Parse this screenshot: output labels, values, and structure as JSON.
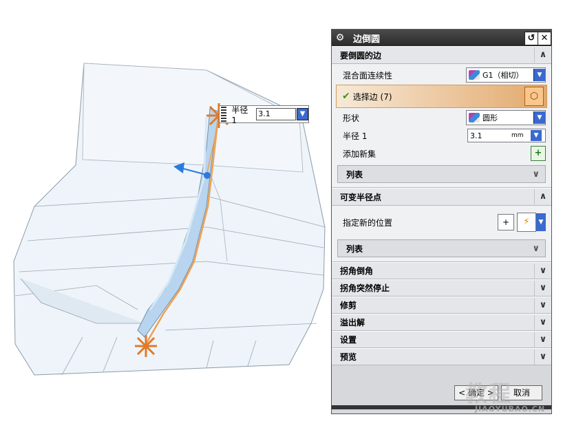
{
  "viewport": {
    "radius_tag": {
      "label": "半径 1",
      "value": "3.1"
    }
  },
  "dialog": {
    "title": "边倒圆",
    "sections": [
      {
        "title": "要倒圆的边",
        "expanded": true,
        "rows": {
          "continuity_label": "混合面连续性",
          "continuity_value": "G1（相切）",
          "select_edge_label": "选择边 (7)",
          "shape_label": "形状",
          "shape_value": "圆形",
          "radius_label": "半径 1",
          "radius_value": "3.1",
          "radius_unit": "mm",
          "add_set_label": "添加新集",
          "list_label": "列表"
        }
      },
      {
        "title": "可变半径点",
        "expanded": true,
        "rows": {
          "new_location_label": "指定新的位置",
          "list_label": "列表"
        }
      }
    ],
    "collapsed_sections": [
      "拐角倒角",
      "拐角突然停止",
      "修剪",
      "溢出解",
      "设置",
      "预览"
    ],
    "ok_label": "< 确定 >",
    "cancel_label": "取消"
  },
  "watermark": {
    "main": "教程",
    "sub": "JIAOYUBAO.CN"
  },
  "colors": {
    "accent": "#3a6ad0",
    "selection": "#e2a96d",
    "edge": "#f0a050"
  }
}
